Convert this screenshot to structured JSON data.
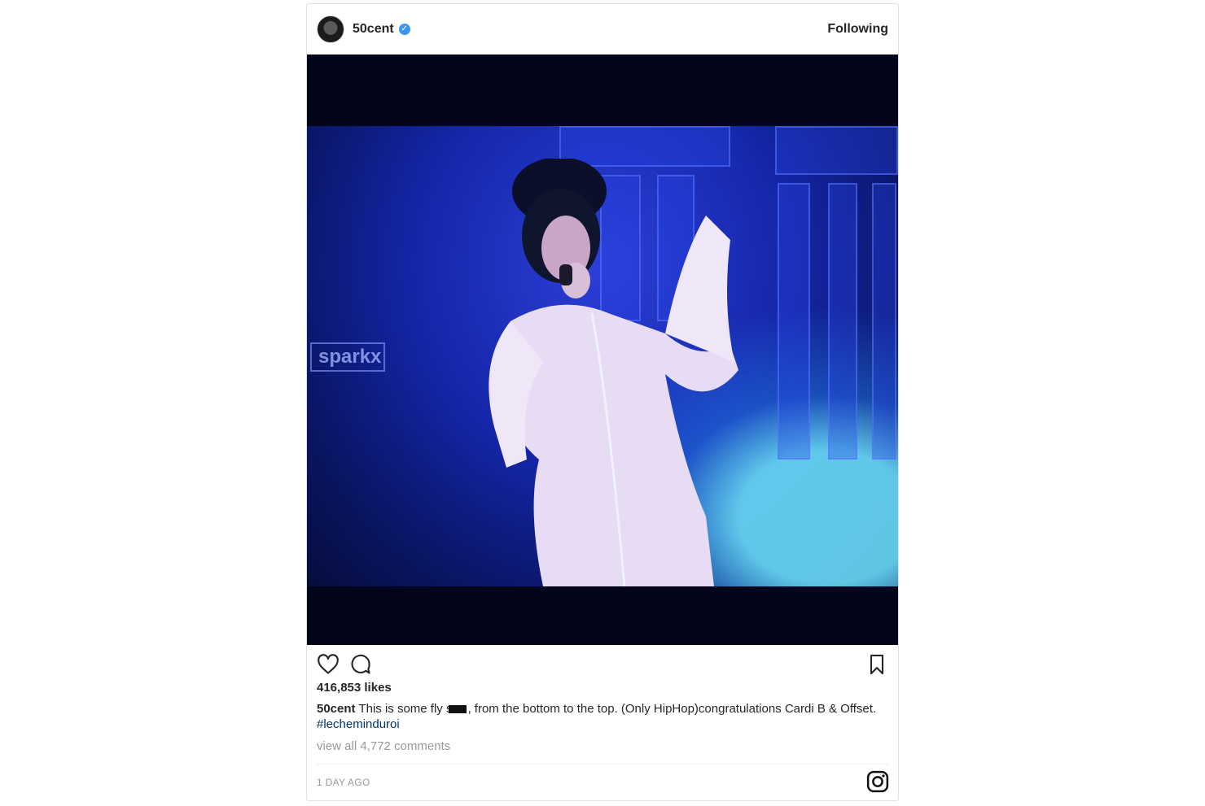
{
  "post": {
    "username": "50cent",
    "verified_mark": "✓",
    "follow_status": "Following",
    "likes": "416,853 likes",
    "caption": {
      "username": "50cent",
      "text_before_censor": "This is some fly s",
      "text_after_censor": ", from the bottom to the top. (Only HipHop)congratulations Cardi B & Offset.",
      "hashtag": "#lecheminduroi"
    },
    "view_comments": "view all 4,772 comments",
    "timestamp": "1 DAY AGO",
    "media_overlay_text": "sparkx"
  },
  "icons": {
    "avatar": "avatar",
    "verified": "verified-badge-icon",
    "like": "heart-icon",
    "comment": "comment-bubble-icon",
    "save": "bookmark-icon",
    "brand": "instagram-icon"
  },
  "colors": {
    "verified_blue": "#3897f0",
    "hashtag": "#003569",
    "muted_text": "#999999",
    "stage_blue": "#1426a8"
  }
}
